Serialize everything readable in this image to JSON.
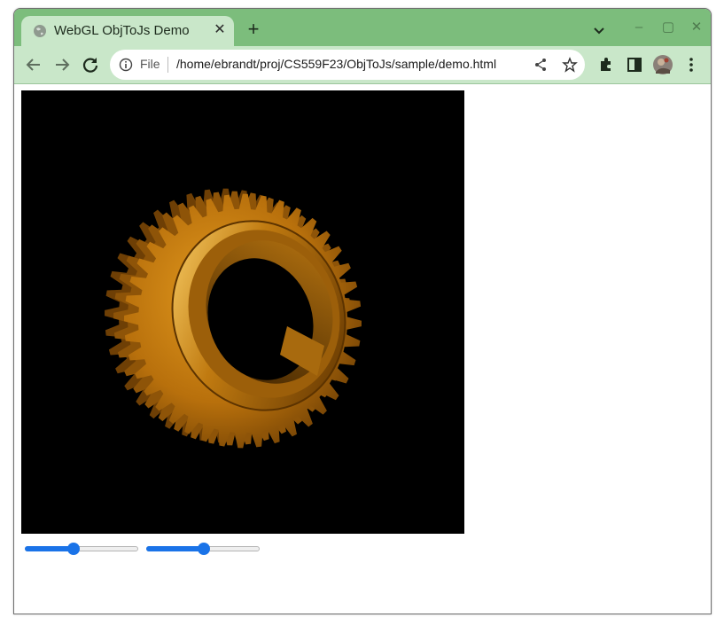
{
  "browser": {
    "tab_title": "WebGL ObjToJs Demo",
    "tab_close": "✕",
    "new_tab": "+",
    "min": "–",
    "max": "▢",
    "close": "✕",
    "scheme_label": "File",
    "url": "/home/ebrandt/proj/CS559F23/ObjToJs/sample/demo.html",
    "theme_color": "#7cbd7c"
  },
  "page": {
    "canvas_background": "#000000",
    "gear_color": "#b06d0a",
    "slider1": {
      "value": 0.42
    },
    "slider2": {
      "value": 0.51
    }
  }
}
